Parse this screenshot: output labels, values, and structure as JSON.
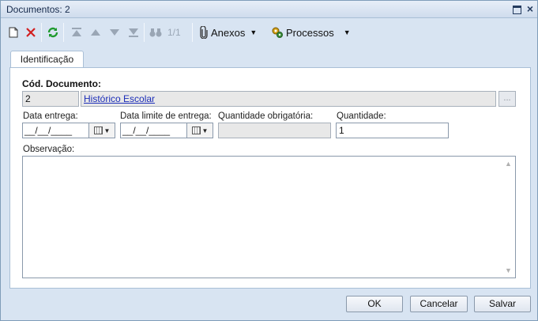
{
  "window": {
    "title": "Documentos: 2"
  },
  "toolbar": {
    "counter": "1/1",
    "attachments_label": "Anexos",
    "processes_label": "Processos"
  },
  "tabs": [
    {
      "label": "Identificação"
    }
  ],
  "form": {
    "doc_code_label": "Cód. Documento:",
    "doc_code_value": "2",
    "doc_name_value": "Histórico Escolar",
    "lookup_label": "...",
    "delivery_date_label": "Data entrega:",
    "delivery_date_value": "__/__/____",
    "deadline_label": "Data limite de entrega:",
    "deadline_value": "__/__/____",
    "required_qty_label": "Quantidade obrigatória:",
    "required_qty_value": "",
    "qty_label": "Quantidade:",
    "qty_value": "1",
    "notes_label": "Observação:",
    "notes_value": ""
  },
  "footer": {
    "ok_label": "OK",
    "cancel_label": "Cancelar",
    "save_label": "Salvar"
  },
  "colors": {
    "link": "#1b2db8",
    "window_bg": "#d8e4f2",
    "delete_red": "#d21f1f",
    "refresh_green": "#1f9a2e"
  }
}
